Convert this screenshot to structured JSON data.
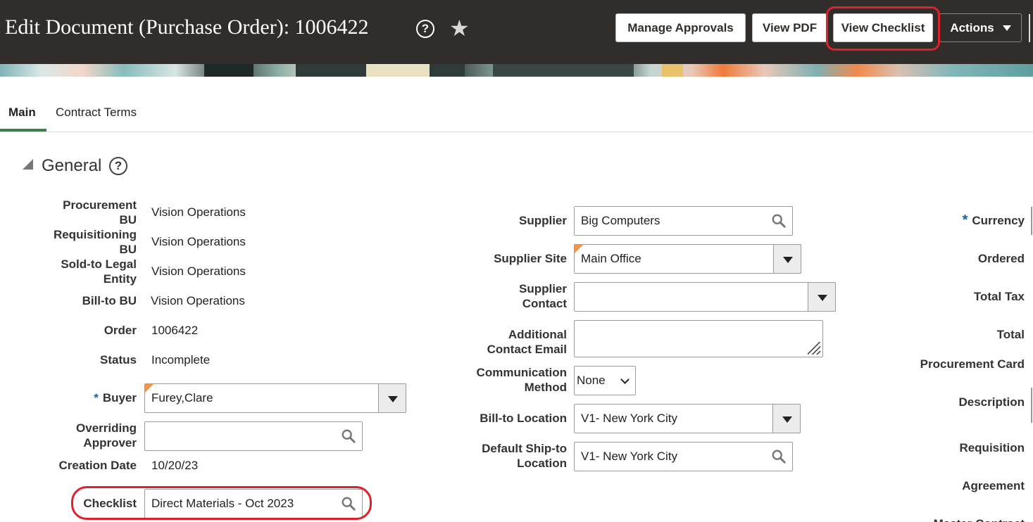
{
  "header": {
    "title": "Edit Document (Purchase Order): 1006422",
    "help_glyph": "?",
    "star_glyph": "★",
    "buttons": {
      "manage_approvals": "Manage Approvals",
      "view_pdf": "View PDF",
      "view_checklist": "View Checklist",
      "actions": "Actions"
    }
  },
  "tabs": [
    {
      "label": "Main",
      "selected": true
    },
    {
      "label": "Contract Terms",
      "selected": false
    }
  ],
  "section": {
    "title": "General",
    "help_glyph": "?"
  },
  "required_mark": "*",
  "left": {
    "procurement_bu": {
      "label": "Procurement BU",
      "value": "Vision Operations"
    },
    "requisitioning_bu": {
      "label": "Requisitioning BU",
      "value": "Vision Operations"
    },
    "sold_to": {
      "label": "Sold-to Legal Entity",
      "value": "Vision Operations"
    },
    "bill_to_bu": {
      "label": "Bill-to BU",
      "value": "Vision Operations"
    },
    "order": {
      "label": "Order",
      "value": "1006422"
    },
    "status": {
      "label": "Status",
      "value": "Incomplete"
    },
    "buyer": {
      "label": "Buyer",
      "value": "Furey,Clare"
    },
    "overriding_approver": {
      "label": "Overriding Approver",
      "value": ""
    },
    "creation_date": {
      "label": "Creation Date",
      "value": "10/20/23"
    },
    "checklist": {
      "label": "Checklist",
      "value": "Direct Materials - Oct 2023"
    }
  },
  "middle": {
    "supplier": {
      "label": "Supplier",
      "value": "Big Computers"
    },
    "supplier_site": {
      "label": "Supplier Site",
      "value": "Main Office"
    },
    "supplier_contact": {
      "label": "Supplier Contact",
      "value": ""
    },
    "additional_email": {
      "label": "Additional Contact Email",
      "value": ""
    },
    "communication_method": {
      "label": "Communication Method",
      "value": "None"
    },
    "bill_to_location": {
      "label": "Bill-to Location",
      "value": "V1- New York City"
    },
    "ship_to_location": {
      "label": "Default Ship-to Location",
      "value": "V1- New York City"
    }
  },
  "right": {
    "currency": "Currency",
    "ordered": "Ordered",
    "total_tax": "Total Tax",
    "total": "Total",
    "procurement_card": "Procurement Card",
    "description": "Description",
    "requisition": "Requisition",
    "agreement": "Agreement",
    "master_contract": "Master Contract"
  },
  "colors": {
    "header_bg": "#312d2a",
    "highlight": "#e0202a",
    "tab_accent": "#3f7d4c",
    "required": "#1d5ea8",
    "new_flag": "#f2954c"
  }
}
